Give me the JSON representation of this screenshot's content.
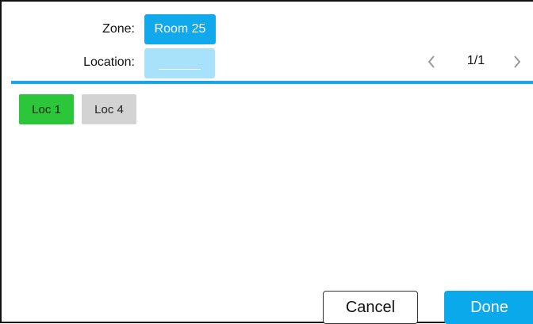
{
  "form": {
    "zone_label": "Zone:",
    "zone_value": "Room 25",
    "location_label": "Location:",
    "location_value": ""
  },
  "pager": {
    "text": "1/1"
  },
  "locations": [
    {
      "label": "Loc 1",
      "state": "selected"
    },
    {
      "label": "Loc 4",
      "state": "default"
    }
  ],
  "actions": {
    "cancel_label": "Cancel",
    "done_label": "Done"
  },
  "colors": {
    "accent": "#12a8ec",
    "selected": "#2cc63a",
    "neutral": "#d3d3d3"
  },
  "icons": {
    "prev": "chevron-left-icon",
    "next": "chevron-right-icon"
  }
}
